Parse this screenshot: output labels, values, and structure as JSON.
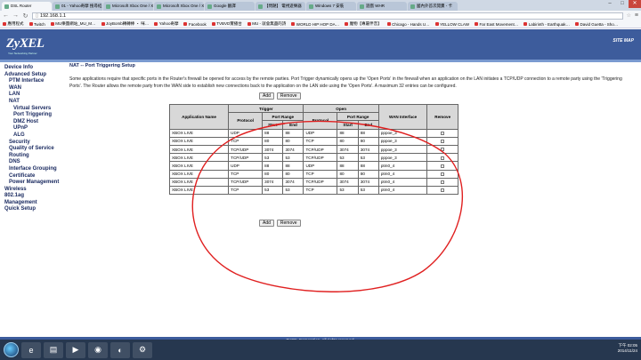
{
  "browser": {
    "tabs": [
      {
        "label": "DSL Router",
        "active": true
      },
      {
        "label": "01 - Yahoo奇摩 搜尋結果"
      },
      {
        "label": "Microsoft Xbox One / Xbo"
      },
      {
        "label": "Microsoft Xbox One / Xbo"
      },
      {
        "label": "Google 翻譯"
      },
      {
        "label": "【問題】 電視遊樂器"
      },
      {
        "label": "Windows 7 安裝"
      },
      {
        "label": "遊戲 WHR"
      },
      {
        "label": "國內外首次開賣 - 卡"
      }
    ],
    "url": "192.168.1.1",
    "bookmarks": [
      "應用程式",
      "Twitch",
      "MU樂團網站_MU_M…",
      "JoyBomb轉轉棒 ・ 咪…",
      "Yahoo奇摩",
      "Facebook",
      "TVBVD實播台",
      "MU - 就會無盡的詩",
      "WORLD HIP HOP DA…",
      "魔物【專屬伴音】",
      "Chicago - Hands U…",
      "YELLOW CLAW",
      "Far East Movement…",
      "Labirinth - Earthquak…",
      "David Guetta - Sho…"
    ]
  },
  "header": {
    "logo": "ZyXEL",
    "tagline": "Your Networking Partner",
    "sitemap": "SITE MAP"
  },
  "sidebar": [
    {
      "label": "Device Info",
      "level": 0
    },
    {
      "label": "Advanced Setup",
      "level": 0
    },
    {
      "label": "PTM Interface",
      "level": 1
    },
    {
      "label": "WAN",
      "level": 1
    },
    {
      "label": "LAN",
      "level": 1
    },
    {
      "label": "NAT",
      "level": 1
    },
    {
      "label": "Virtual Servers",
      "level": 2
    },
    {
      "label": "Port Triggering",
      "level": 2
    },
    {
      "label": "DMZ Host",
      "level": 2
    },
    {
      "label": "UPnP",
      "level": 2
    },
    {
      "label": "ALG",
      "level": 2
    },
    {
      "label": "Security",
      "level": 1
    },
    {
      "label": "Quality of Service",
      "level": 1
    },
    {
      "label": "Routing",
      "level": 1
    },
    {
      "label": "DNS",
      "level": 1
    },
    {
      "label": "Interface Grouping",
      "level": 1
    },
    {
      "label": "Certificate",
      "level": 1
    },
    {
      "label": "Power Management",
      "level": 1
    },
    {
      "label": "Wireless",
      "level": 0
    },
    {
      "label": "802.1ag",
      "level": 0
    },
    {
      "label": "Management",
      "level": 0
    },
    {
      "label": "Quick Setup",
      "level": 0
    }
  ],
  "main": {
    "title": "NAT -- Port Triggering Setup",
    "description": "Some applications require that specific ports in the Router's firewall be opened for access by the remote parties. Port Trigger dynamically opens up the 'Open Ports' in the firewall when an application on the LAN initiates a TCP/UDP connection to a remote party using the 'Triggering Ports'. The Router allows the remote party from the WAN side to establish new connections back to the application on the LAN side using the 'Open Ports'. A maximum 32 entries can be configured.",
    "add_label": "Add",
    "remove_label": "Remove"
  },
  "table": {
    "headers": {
      "app_name": "Application Name",
      "trigger": "Trigger",
      "open": "Open",
      "protocol": "Protocol",
      "port_range": "Port Range",
      "start": "Start",
      "end": "End",
      "wan_interface": "WAN Interface",
      "remove": "Remove"
    },
    "rows": [
      {
        "app": "XBOX LIVE",
        "tproto": "UDP",
        "tstart": "88",
        "tend": "88",
        "oproto": "UDP",
        "ostart": "88",
        "oend": "88",
        "wan": "pppoe_3"
      },
      {
        "app": "XBOX LIVE",
        "tproto": "TCP",
        "tstart": "80",
        "tend": "80",
        "oproto": "TCP",
        "ostart": "80",
        "oend": "80",
        "wan": "pppoe_3"
      },
      {
        "app": "XBOX LIVE",
        "tproto": "TCP/UDP",
        "tstart": "3074",
        "tend": "3074",
        "oproto": "TCP/UDP",
        "ostart": "3074",
        "oend": "3074",
        "wan": "pppoe_3"
      },
      {
        "app": "XBOX LIVE",
        "tproto": "TCP/UDP",
        "tstart": "53",
        "tend": "53",
        "oproto": "TCP/UDP",
        "ostart": "53",
        "oend": "53",
        "wan": "pppoe_3"
      },
      {
        "app": "XBOX LIVE",
        "tproto": "UDP",
        "tstart": "88",
        "tend": "88",
        "oproto": "UDP",
        "ostart": "88",
        "oend": "88",
        "wan": "ptm0_4"
      },
      {
        "app": "XBOX LIVE",
        "tproto": "TCP",
        "tstart": "80",
        "tend": "80",
        "oproto": "TCP",
        "ostart": "80",
        "oend": "80",
        "wan": "ptm0_4"
      },
      {
        "app": "XBOX LIVE",
        "tproto": "TCP/UDP",
        "tstart": "3074",
        "tend": "3074",
        "oproto": "TCP/UDP",
        "ostart": "3074",
        "oend": "3074",
        "wan": "ptm0_4"
      },
      {
        "app": "XBOX LIVE",
        "tproto": "TCP",
        "tstart": "53",
        "tend": "53",
        "oproto": "TCP",
        "ostart": "53",
        "oend": "53",
        "wan": "ptm0_4"
      }
    ]
  },
  "footer": {
    "copyright": "ZyXEL Corporation. All rights reserved."
  },
  "taskbar": {
    "time": "下午 02:05",
    "date": "2014/11/24"
  },
  "colors": {
    "header": "#3d5c9c",
    "annotation": "#e02020"
  }
}
